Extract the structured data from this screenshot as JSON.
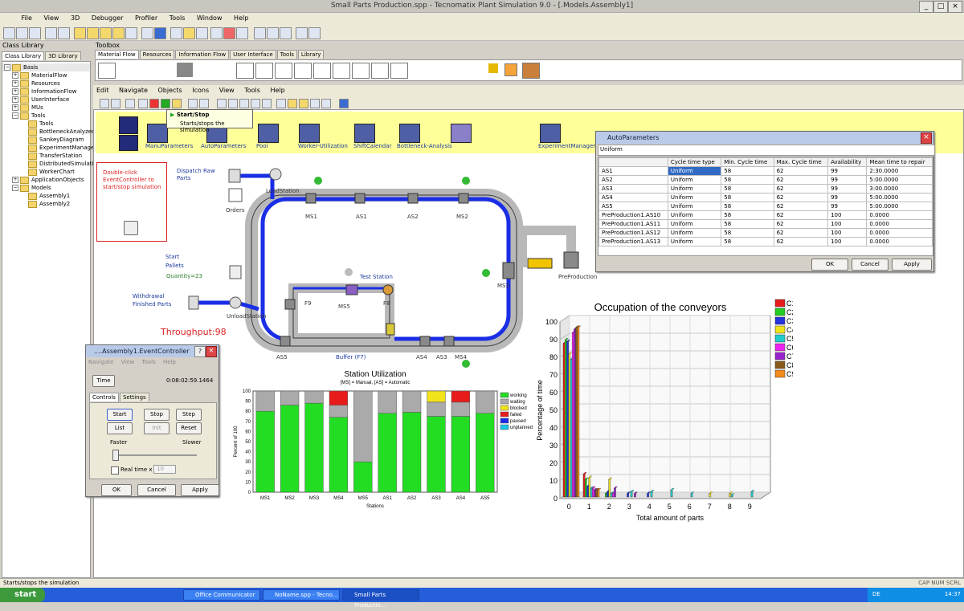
{
  "window": {
    "title": "Small Parts Production.spp - Tecnomatix Plant Simulation 9.0 - [.Models.Assembly1]"
  },
  "menu": [
    "File",
    "View",
    "3D",
    "Debugger",
    "Profiler",
    "Tools",
    "Window",
    "Help"
  ],
  "class_library": {
    "header": "Class Library",
    "tabs": [
      "Class Library",
      "3D Library"
    ],
    "tree": [
      {
        "label": "Basis",
        "level": 0,
        "expanded": true
      },
      {
        "label": "MaterialFlow",
        "level": 1
      },
      {
        "label": "Resources",
        "level": 1
      },
      {
        "label": "InformationFlow",
        "level": 1
      },
      {
        "label": "UserInterface",
        "level": 1
      },
      {
        "label": "MUs",
        "level": 1
      },
      {
        "label": "Tools",
        "level": 1,
        "expanded": true
      },
      {
        "label": "Tools",
        "level": 2
      },
      {
        "label": "BottleneckAnalyzer",
        "level": 2
      },
      {
        "label": "SankeyDiagram",
        "level": 2
      },
      {
        "label": "ExperimentManager",
        "level": 2
      },
      {
        "label": "TransferStation",
        "level": 2
      },
      {
        "label": "DistributedSimulation",
        "level": 2
      },
      {
        "label": "WorkerChart",
        "level": 2
      },
      {
        "label": "ApplicationObjects",
        "level": 1
      },
      {
        "label": "Models",
        "level": 1,
        "expanded": true
      },
      {
        "label": "Assembly1",
        "level": 2
      },
      {
        "label": "Assembly2",
        "level": 2
      }
    ]
  },
  "toolbox": {
    "header": "Toolbox",
    "tabs": [
      "Material Flow",
      "Resources",
      "Information Flow",
      "User Interface",
      "Tools",
      "Library"
    ]
  },
  "frame_menu": [
    "Edit",
    "Navigate",
    "Objects",
    "Icons",
    "View",
    "Tools",
    "Help"
  ],
  "tooltip": {
    "title": "Start/Stop",
    "text": "Starts/stops the simulation"
  },
  "model": {
    "frame_icons": [
      "ManuParameters",
      "AutoParameters",
      "Pool",
      "Worker-Utilization",
      "ShiftCalendar",
      "Bottleneck-Analysis",
      "ExperimentManager"
    ],
    "hint": "Double-click EventController to start/stop simulation",
    "dispatch": "Dispatch Raw Parts",
    "orders": "Orders",
    "load_station": "LoadStation",
    "stations_top": [
      "MS1",
      "AS1",
      "AS2",
      "MS2"
    ],
    "start_pallets": "Start Pallets",
    "quantity": "Quantity=23",
    "withdrawal": "Withdrawal Finished Parts",
    "unload_station": "UnloadStation",
    "throughput": "Throughput:98",
    "test_station": "Test Station",
    "ms5": "MS5",
    "f9": "F9",
    "f8": "F8",
    "as5": "AS5",
    "buffer": "Buffer (F7)",
    "stations_bottom": [
      "AS4",
      "AS3",
      "MS4"
    ],
    "ms3": "MS3",
    "preproduction": "PreProduction"
  },
  "auto_parameters": {
    "title": "AutoParameters",
    "field": "Uniform",
    "columns": [
      "",
      "Cycle time type",
      "Min. Cycle time",
      "Max. Cycle time",
      "Availability",
      "Mean time to repair"
    ],
    "rows": [
      [
        "AS1",
        "Uniform",
        "58",
        "62",
        "99",
        "2:30.0000"
      ],
      [
        "AS2",
        "Uniform",
        "58",
        "62",
        "99",
        "5:00.0000"
      ],
      [
        "AS3",
        "Uniform",
        "58",
        "62",
        "99",
        "3:00.0000"
      ],
      [
        "AS4",
        "Uniform",
        "58",
        "62",
        "99",
        "5:00.0000"
      ],
      [
        "AS5",
        "Uniform",
        "58",
        "62",
        "99",
        "5:00.0000"
      ],
      [
        "PreProduction1.AS10",
        "Uniform",
        "58",
        "62",
        "100",
        "0.0000"
      ],
      [
        "PreProduction1.AS11",
        "Uniform",
        "58",
        "62",
        "100",
        "0.0000"
      ],
      [
        "PreProduction1.AS12",
        "Uniform",
        "58",
        "62",
        "100",
        "0.0000"
      ],
      [
        "PreProduction1.AS13",
        "Uniform",
        "58",
        "62",
        "100",
        "0.0000"
      ]
    ],
    "buttons": [
      "OK",
      "Cancel",
      "Apply"
    ]
  },
  "event_controller": {
    "title": "....Assembly1.EventController",
    "menu": [
      "Navigate",
      "View",
      "Tools",
      "Help"
    ],
    "time_button": "Time",
    "time_value": "0:08:02:59.1464",
    "tabs": [
      "Controls",
      "Settings"
    ],
    "buttons": [
      "Start",
      "Stop",
      "Step",
      "List",
      "Init",
      "Reset"
    ],
    "faster": "Faster",
    "slower": "Slower",
    "real_time": "Real time x",
    "real_time_value": "10",
    "footer_buttons": [
      "OK",
      "Cancel",
      "Apply"
    ]
  },
  "chart_data": [
    {
      "type": "bar",
      "stacked": true,
      "title": "Station Utilization",
      "subtitle": "[MS] = Manual, [AS] = Automatic",
      "xlabel": "Stations",
      "ylabel": "Percent of 100",
      "ylim": [
        0,
        100
      ],
      "yticks": [
        0,
        10,
        20,
        30,
        40,
        50,
        60,
        70,
        80,
        90,
        100
      ],
      "categories": [
        "MS1",
        "MS2",
        "MS3",
        "MS4",
        "MS5",
        "AS1",
        "AS2",
        "AS3",
        "AS4",
        "AS5"
      ],
      "series": [
        {
          "name": "working",
          "color": "#22dd22",
          "values": [
            80,
            86,
            88,
            74,
            30,
            78,
            79,
            75,
            75,
            78
          ]
        },
        {
          "name": "waiting",
          "color": "#aaaaaa",
          "values": [
            20,
            14,
            12,
            12,
            70,
            22,
            21,
            14,
            14,
            22
          ]
        },
        {
          "name": "blocked",
          "color": "#f2e21c",
          "values": [
            0,
            0,
            0,
            0,
            0,
            0,
            0,
            11,
            0,
            0
          ]
        },
        {
          "name": "failed",
          "color": "#e81b1b",
          "values": [
            0,
            0,
            0,
            14,
            0,
            0,
            0,
            0,
            11,
            0
          ]
        },
        {
          "name": "paused",
          "color": "#1b2be8",
          "values": [
            0,
            0,
            0,
            0,
            0,
            0,
            0,
            0,
            0,
            0
          ]
        },
        {
          "name": "unplanned",
          "color": "#1bc3e8",
          "values": [
            0,
            0,
            0,
            0,
            0,
            0,
            0,
            0,
            0,
            0
          ]
        }
      ],
      "legend": "right"
    },
    {
      "type": "bar",
      "title": "Occupation of the conveyors",
      "xlabel": "Total amount of parts",
      "ylabel": "Percentage of time",
      "ylim": [
        0,
        100
      ],
      "yticks": [
        0,
        10,
        20,
        30,
        40,
        50,
        60,
        70,
        80,
        90,
        100
      ],
      "categories": [
        "0",
        "1",
        "2",
        "3",
        "4",
        "5",
        "6",
        "7",
        "8",
        "9"
      ],
      "series": [
        {
          "name": "C1",
          "color": "#e81b1b",
          "values": [
            87,
            13,
            0,
            0,
            0,
            0,
            0,
            0,
            0,
            0
          ]
        },
        {
          "name": "C2",
          "color": "#22cc22",
          "values": [
            89,
            10,
            2,
            0,
            0,
            0,
            0,
            0,
            0,
            0
          ]
        },
        {
          "name": "C3",
          "color": "#2233dd",
          "values": [
            88,
            6,
            3,
            2,
            2,
            0,
            0,
            0,
            0,
            0
          ]
        },
        {
          "name": "C4",
          "color": "#f2e21c",
          "values": [
            81,
            11,
            10,
            0,
            0,
            0,
            0,
            2,
            2,
            0
          ]
        },
        {
          "name": "C5",
          "color": "#22cccc",
          "values": [
            78,
            5,
            2,
            3,
            3,
            4,
            2,
            0,
            1,
            3
          ]
        },
        {
          "name": "C6",
          "color": "#ee22ee",
          "values": [
            93,
            5,
            2,
            0,
            0,
            0,
            0,
            0,
            0,
            0
          ]
        },
        {
          "name": "C7",
          "color": "#9922cc",
          "values": [
            95,
            4,
            5,
            2,
            0,
            0,
            0,
            0,
            0,
            0
          ]
        },
        {
          "name": "C8",
          "color": "#8a5a1a",
          "values": [
            96,
            4,
            0,
            0,
            0,
            0,
            0,
            0,
            0,
            0
          ]
        },
        {
          "name": "C9",
          "color": "#f28a1c",
          "values": [
            96,
            4,
            0,
            0,
            0,
            0,
            0,
            0,
            0,
            0
          ]
        }
      ],
      "legend": "right"
    }
  ],
  "status_bar": {
    "text": "Starts/stops the simulation",
    "indicators": "CAP  NUM  SCRL"
  },
  "taskbar": {
    "start": "start",
    "items": [
      "Office Communicator",
      "NoName.spp - Tecno...",
      "Small Parts Productio..."
    ],
    "lang": "DE",
    "clock": "14:37"
  }
}
